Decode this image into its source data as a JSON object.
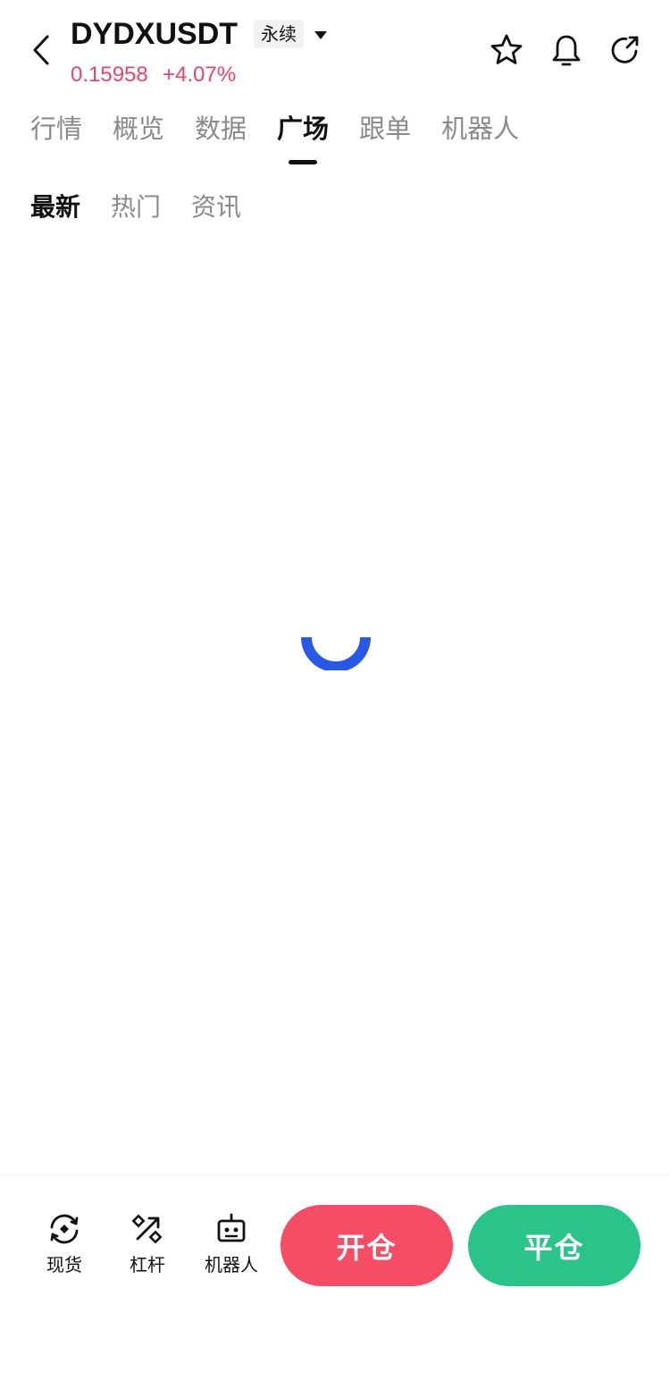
{
  "header": {
    "symbol": "DYDXUSDT",
    "contract_type": "永续",
    "price": "0.15958",
    "change": "+4.07%",
    "icons": {
      "back": "chevron-left-icon",
      "dropdown": "caret-down-icon",
      "favorite": "star-icon",
      "alert": "bell-icon",
      "share": "refresh-share-icon"
    }
  },
  "main_tabs": [
    {
      "label": "行情",
      "active": false
    },
    {
      "label": "概览",
      "active": false
    },
    {
      "label": "数据",
      "active": false
    },
    {
      "label": "广场",
      "active": true
    },
    {
      "label": "跟单",
      "active": false
    },
    {
      "label": "机器人",
      "active": false
    }
  ],
  "sub_tabs": [
    {
      "label": "最新",
      "active": true
    },
    {
      "label": "热门",
      "active": false
    },
    {
      "label": "资讯",
      "active": false
    }
  ],
  "loading": {
    "icon": "loading-spinner-icon",
    "color": "#2758e6"
  },
  "bottom_bar": {
    "tools": [
      {
        "label": "现货",
        "icon": "spot-exchange-icon"
      },
      {
        "label": "杠杆",
        "icon": "margin-percent-icon"
      },
      {
        "label": "机器人",
        "icon": "robot-icon"
      }
    ],
    "open_label": "开仓",
    "close_label": "平仓"
  },
  "colors": {
    "up": "#e8456a",
    "open_button": "#f54d66",
    "close_button": "#2ac48a",
    "active_text": "#111111",
    "inactive_text": "#8a8a8a"
  }
}
